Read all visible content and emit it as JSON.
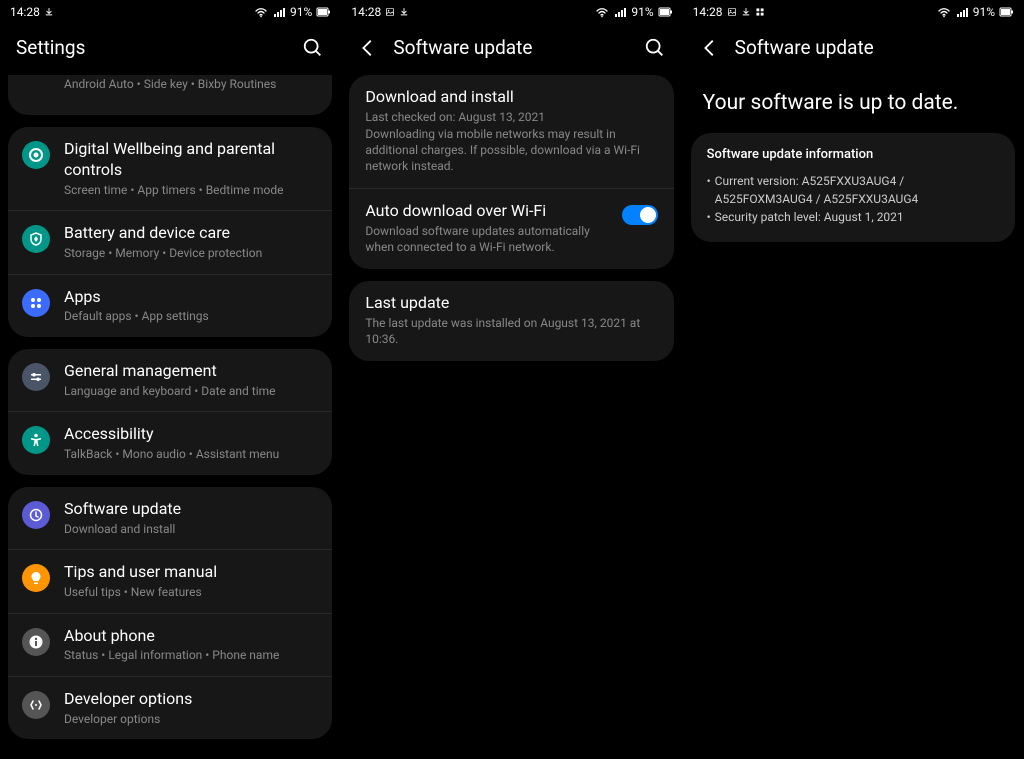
{
  "statusbar": {
    "time": "14:28",
    "battery_pct": "91%"
  },
  "screen1": {
    "title": "Settings",
    "partial_item_sub": "Android Auto  •  Side key  •  Bixby Routines",
    "group1": [
      {
        "title": "Digital Wellbeing and parental controls",
        "sub": "Screen time  •  App timers  •  Bedtime mode",
        "bg": "#009688",
        "icon": "wellbeing"
      },
      {
        "title": "Battery and device care",
        "sub": "Storage  •  Memory  •  Device protection",
        "bg": "#009688",
        "icon": "care"
      },
      {
        "title": "Apps",
        "sub": "Default apps  •  App settings",
        "bg": "#3b6bff",
        "icon": "apps"
      }
    ],
    "group2": [
      {
        "title": "General management",
        "sub": "Language and keyboard  •  Date and time",
        "bg": "#4a5568",
        "icon": "general"
      },
      {
        "title": "Accessibility",
        "sub": "TalkBack  •  Mono audio  •  Assistant menu",
        "bg": "#009688",
        "icon": "accessibility"
      }
    ],
    "group3": [
      {
        "title": "Software update",
        "sub": "Download and install",
        "bg": "#5b5bd6",
        "icon": "update"
      },
      {
        "title": "Tips and user manual",
        "sub": "Useful tips  •  New features",
        "bg": "#ff9500",
        "icon": "tips"
      },
      {
        "title": "About phone",
        "sub": "Status  •  Legal information  •  Phone name",
        "bg": "#555",
        "icon": "about"
      },
      {
        "title": "Developer options",
        "sub": "Developer options",
        "bg": "#555",
        "icon": "dev"
      }
    ]
  },
  "screen2": {
    "title": "Software update",
    "download": {
      "title": "Download and install",
      "sub1": "Last checked on: August 13, 2021",
      "sub2": "Downloading via mobile networks may result in additional charges. If possible, download via a Wi-Fi network instead."
    },
    "auto": {
      "title": "Auto download over Wi-Fi",
      "sub": "Download software updates automatically when connected to a Wi-Fi network."
    },
    "last": {
      "title": "Last update",
      "sub": "The last update was installed on August 13, 2021 at 10:36."
    }
  },
  "screen3": {
    "title": "Software update",
    "hero": "Your software is up to date.",
    "info_title": "Software update information",
    "version_label": "Current version: ",
    "version_value": "A525FXXU3AUG4 / A525FOXM3AUG4 / A525FXXU3AUG4",
    "security_label": "Security patch level: ",
    "security_value": "August 1, 2021"
  }
}
